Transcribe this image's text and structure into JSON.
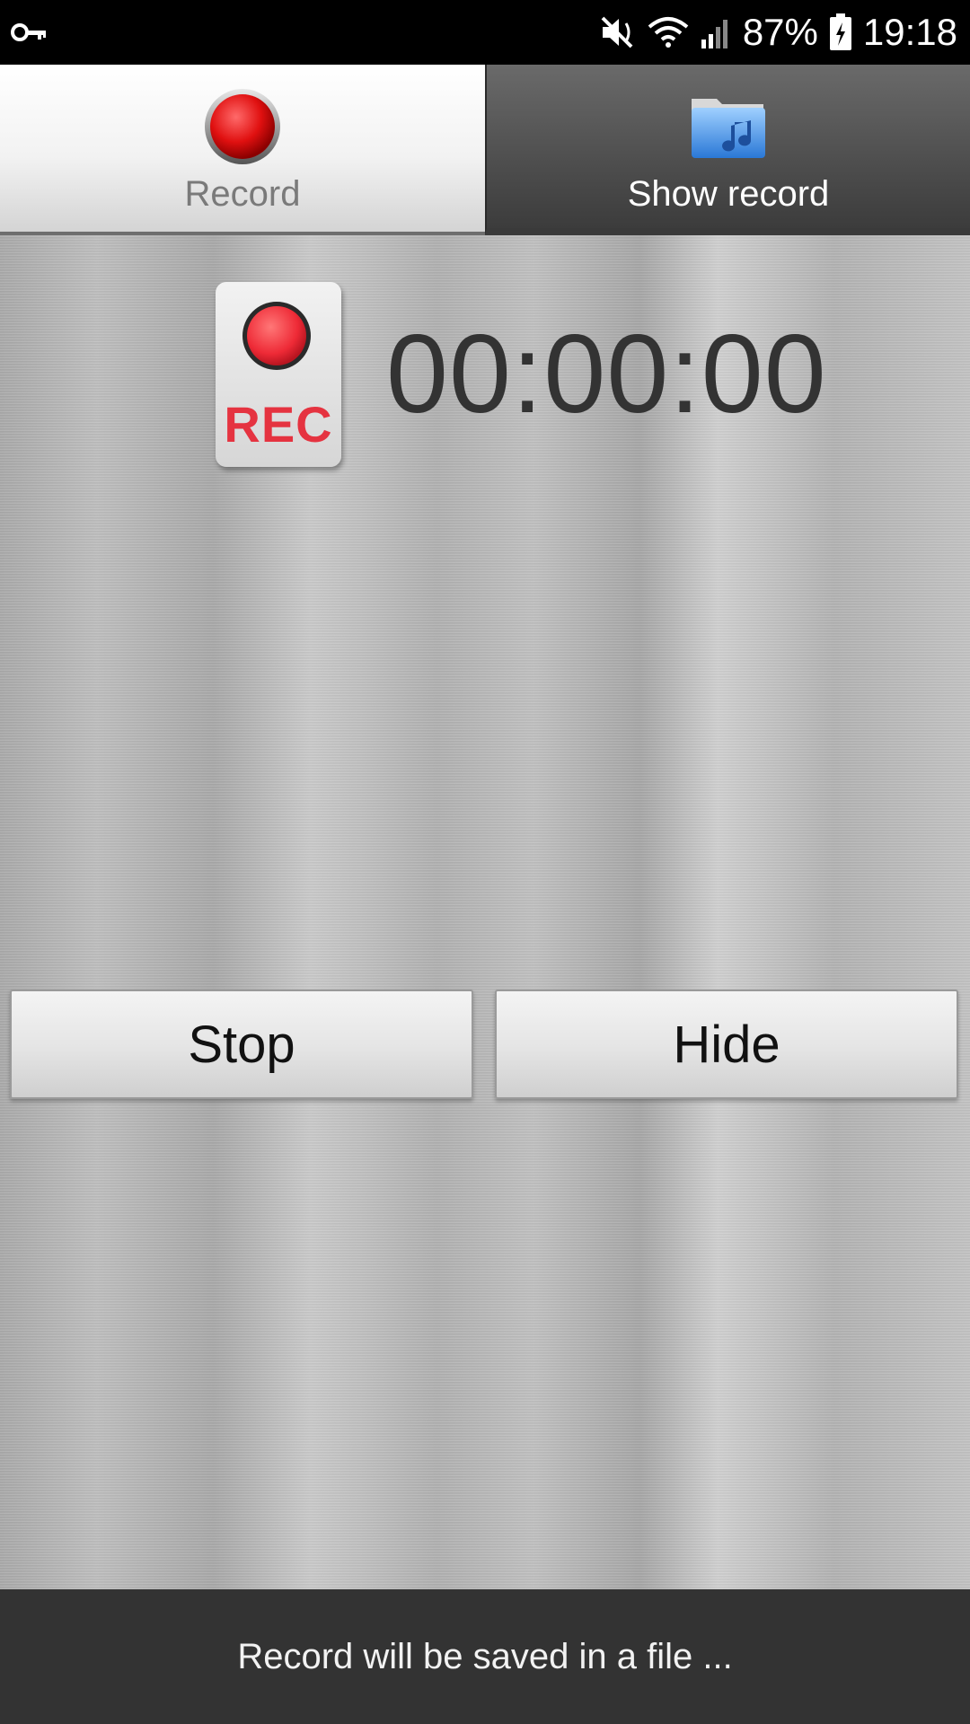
{
  "status_bar": {
    "battery": "87%",
    "time": "19:18",
    "icons": [
      "key-icon",
      "mute-icon",
      "wifi-icon",
      "signal-icon",
      "battery-icon"
    ]
  },
  "tabs": [
    {
      "label": "Record",
      "icon": "record-dot-icon",
      "selected": true
    },
    {
      "label": "Show record",
      "icon": "music-folder-icon",
      "selected": false
    }
  ],
  "recorder": {
    "rec_label": "REC",
    "timer": "00:00:00"
  },
  "actions": {
    "stop_label": "Stop",
    "hide_label": "Hide"
  },
  "toast": {
    "message": "Record will be saved in a file ..."
  },
  "colors": {
    "rec_red": "#e53340",
    "status_bar": "#000000",
    "toast_bg": "#333333"
  }
}
